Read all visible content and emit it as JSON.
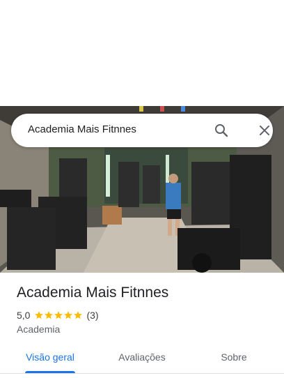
{
  "search": {
    "query": "Academia Mais Fitnnes"
  },
  "icons": {
    "search": "search-icon",
    "close": "close-icon",
    "star": "star-icon"
  },
  "colors": {
    "accent": "#1a73e8",
    "star": "#fbbc04"
  },
  "place": {
    "name": "Academia Mais Fitnnes",
    "rating": "5,0",
    "stars": 5,
    "reviews": "(3)",
    "category": "Academia"
  },
  "tabs": [
    {
      "label": "Visão geral",
      "active": true
    },
    {
      "label": "Avaliações",
      "active": false
    },
    {
      "label": "Sobre",
      "active": false
    }
  ]
}
